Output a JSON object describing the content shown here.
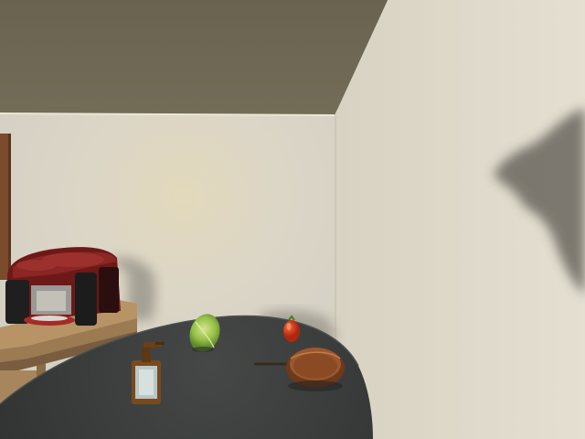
{
  "scene": {
    "kind": "3D indoor kitchen render",
    "objects": [
      {
        "name": "ceiling"
      },
      {
        "name": "back-wall"
      },
      {
        "name": "right-wall"
      },
      {
        "name": "door-frame"
      },
      {
        "name": "side-counter"
      },
      {
        "name": "coffee-machine"
      },
      {
        "name": "dark-round-table"
      },
      {
        "name": "lettuce"
      },
      {
        "name": "tomato"
      },
      {
        "name": "soap-dispenser"
      },
      {
        "name": "frying-pan"
      }
    ],
    "colors": {
      "ceiling": "#6c6551",
      "back_wall": "#dbd5c4",
      "right_wall": "#ddd7c8",
      "table": "#3a3d3b",
      "counter": "#b08f66",
      "machine": "#7a1d1b",
      "lettuce": "#8fbf43",
      "tomato": "#d23a1e",
      "pan": "#8a4a24"
    }
  }
}
